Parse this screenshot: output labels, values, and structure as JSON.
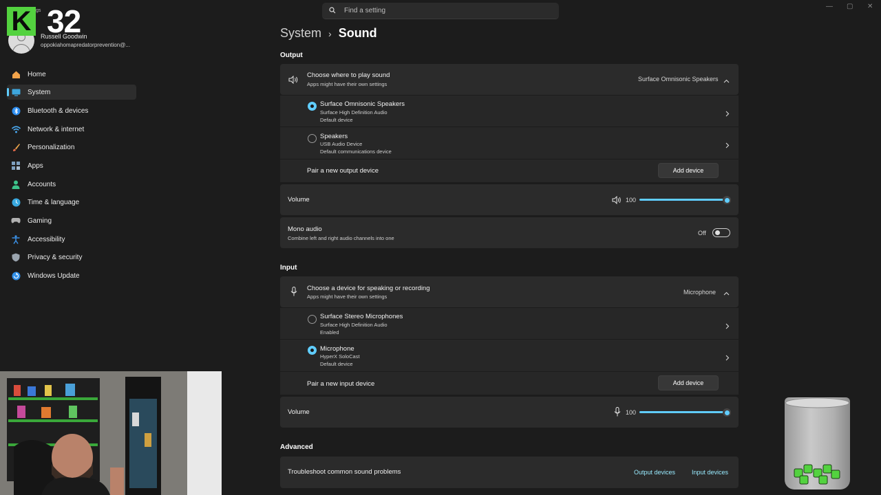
{
  "window": {
    "minimize_glyph": "—",
    "maximize_glyph": "▢",
    "close_glyph": "✕"
  },
  "search": {
    "placeholder": "Find a setting"
  },
  "overlay": {
    "logo_letter": "K",
    "counter": "32",
    "tiny_text": "gs"
  },
  "profile": {
    "name": "Russell Goodwin",
    "email": "oppokiahomapredatorprevention@..."
  },
  "sidebar": {
    "items": [
      {
        "label": "Home",
        "icon": "home-icon",
        "color": "#f2a34a"
      },
      {
        "label": "System",
        "icon": "system-icon",
        "color": "#3ea6dd",
        "active": true
      },
      {
        "label": "Bluetooth & devices",
        "icon": "bluetooth-icon",
        "color": "#2e8ef0"
      },
      {
        "label": "Network & internet",
        "icon": "wifi-icon",
        "color": "#4aa8f0"
      },
      {
        "label": "Personalization",
        "icon": "brush-icon",
        "color": "#e36b4a"
      },
      {
        "label": "Apps",
        "icon": "apps-icon",
        "color": "#7ea0c0"
      },
      {
        "label": "Accounts",
        "icon": "person-icon",
        "color": "#3cc28a"
      },
      {
        "label": "Time & language",
        "icon": "globe-clock-icon",
        "color": "#39a9e0"
      },
      {
        "label": "Gaming",
        "icon": "gamepad-icon",
        "color": "#b0b0b0"
      },
      {
        "label": "Accessibility",
        "icon": "accessibility-icon",
        "color": "#3a8fe3"
      },
      {
        "label": "Privacy & security",
        "icon": "shield-icon",
        "color": "#9aa4ae"
      },
      {
        "label": "Windows Update",
        "icon": "update-icon",
        "color": "#2f8ee8"
      }
    ]
  },
  "breadcrumb": {
    "parent": "System",
    "separator": "›",
    "current": "Sound"
  },
  "output": {
    "section_label": "Output",
    "chooser": {
      "title": "Choose where to play sound",
      "subtitle": "Apps might have their own settings",
      "selected": "Surface Omnisonic Speakers"
    },
    "devices": [
      {
        "name": "Surface Omnisonic Speakers",
        "line1": "Surface High Definition Audio",
        "line2": "Default device",
        "checked": true
      },
      {
        "name": "Speakers",
        "line1": "USB Audio Device",
        "line2": "Default communications device",
        "checked": false
      }
    ],
    "pair_label": "Pair a new output device",
    "add_button": "Add device",
    "volume": {
      "label": "Volume",
      "value": "100",
      "level": 1.0
    },
    "mono": {
      "title": "Mono audio",
      "subtitle": "Combine left and right audio channels into one",
      "state": "Off"
    }
  },
  "input": {
    "section_label": "Input",
    "chooser": {
      "title": "Choose a device for speaking or recording",
      "subtitle": "Apps might have their own settings",
      "selected": "Microphone"
    },
    "devices": [
      {
        "name": "Surface Stereo Microphones",
        "line1": "Surface High Definition Audio",
        "line2": "Enabled",
        "checked": false
      },
      {
        "name": "Microphone",
        "line1": "HyperX SoloCast",
        "line2": "Default device",
        "checked": true
      }
    ],
    "pair_label": "Pair a new input device",
    "add_button": "Add device",
    "volume": {
      "label": "Volume",
      "value": "100",
      "level": 1.0
    }
  },
  "advanced": {
    "section_label": "Advanced",
    "troubleshoot": {
      "title": "Troubleshoot common sound problems",
      "output_link": "Output devices",
      "input_link": "Input devices"
    }
  },
  "colors": {
    "accent": "#60cdff",
    "background": "#1c1c1c",
    "card": "#2b2b2b",
    "logo_green": "#53d23f"
  }
}
